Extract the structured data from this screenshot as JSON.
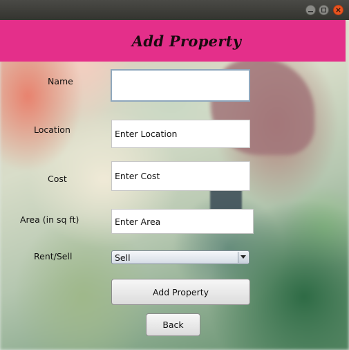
{
  "window": {
    "controls": {
      "minimize_icon": "minimize-icon",
      "maximize_icon": "maximize-icon",
      "close_icon": "close-icon",
      "close_color": "#e95420"
    }
  },
  "header": {
    "title": "Add Property",
    "background": "#e42f8a"
  },
  "form": {
    "name": {
      "label": "Name",
      "value": ""
    },
    "location": {
      "label": "Location",
      "value": "Enter Location"
    },
    "cost": {
      "label": "Cost",
      "value": "Enter Cost"
    },
    "area": {
      "label": "Area (in sq ft)",
      "value": "Enter Area"
    },
    "rent_sell": {
      "label": "Rent/Sell",
      "selected": "Sell"
    }
  },
  "buttons": {
    "add_property": "Add Property",
    "back": "Back"
  }
}
